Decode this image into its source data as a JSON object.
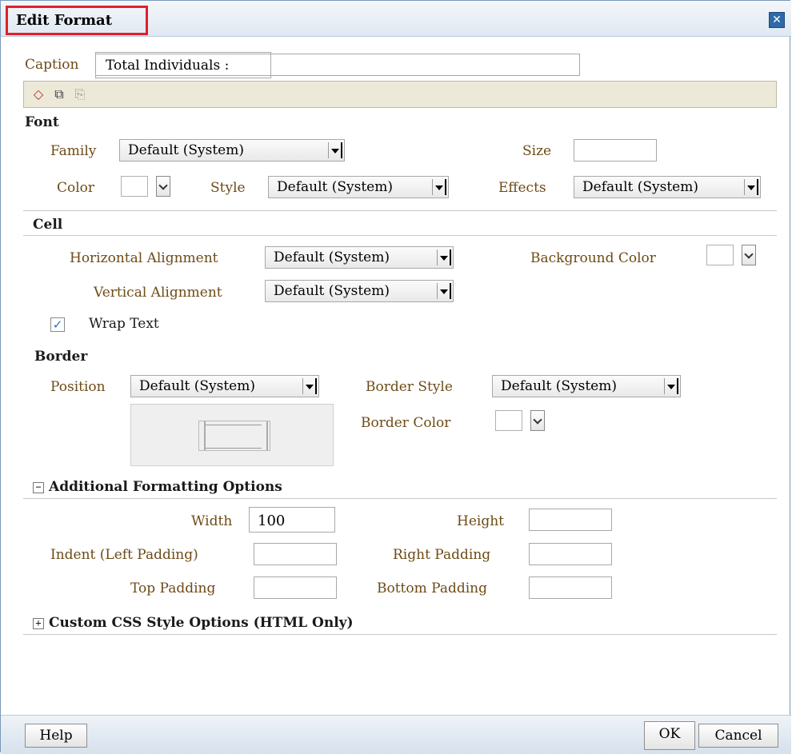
{
  "dialog": {
    "title": "Edit Format",
    "close_icon": "close-icon"
  },
  "caption": {
    "label": "Caption",
    "value": "Total Individuals :"
  },
  "toolbar": {
    "icons": [
      "eraser-icon",
      "copy-icon",
      "paste-icon"
    ]
  },
  "font": {
    "section": "Font",
    "family_label": "Family",
    "family_value": "Default (System)",
    "size_label": "Size",
    "size_value": "",
    "color_label": "Color",
    "style_label": "Style",
    "style_value": "Default (System)",
    "effects_label": "Effects",
    "effects_value": "Default (System)"
  },
  "cell": {
    "section": "Cell",
    "halign_label": "Horizontal Alignment",
    "halign_value": "Default (System)",
    "bgcolor_label": "Background Color",
    "valign_label": "Vertical Alignment",
    "valign_value": "Default (System)",
    "wrap_label": "Wrap Text",
    "wrap_checked": true
  },
  "border": {
    "section": "Border",
    "position_label": "Position",
    "position_value": "Default (System)",
    "style_label": "Border Style",
    "style_value": "Default (System)",
    "color_label": "Border Color"
  },
  "additional": {
    "section": "Additional Formatting Options",
    "toggle": "−",
    "width_label": "Width",
    "width_value": "100",
    "height_label": "Height",
    "height_value": "",
    "indent_label": "Indent (Left Padding)",
    "indent_value": "",
    "right_label": "Right Padding",
    "right_value": "",
    "top_label": "Top Padding",
    "top_value": "",
    "bottom_label": "Bottom Padding",
    "bottom_value": ""
  },
  "custom_css": {
    "section": "Custom CSS Style Options (HTML Only)",
    "toggle": "+"
  },
  "footer": {
    "help": "Help",
    "ok": "OK",
    "cancel": "Cancel"
  },
  "colors": {
    "label_color": "#6d4b16",
    "highlight": "#e0202a",
    "toolbar_bg": "#ece9d8"
  }
}
